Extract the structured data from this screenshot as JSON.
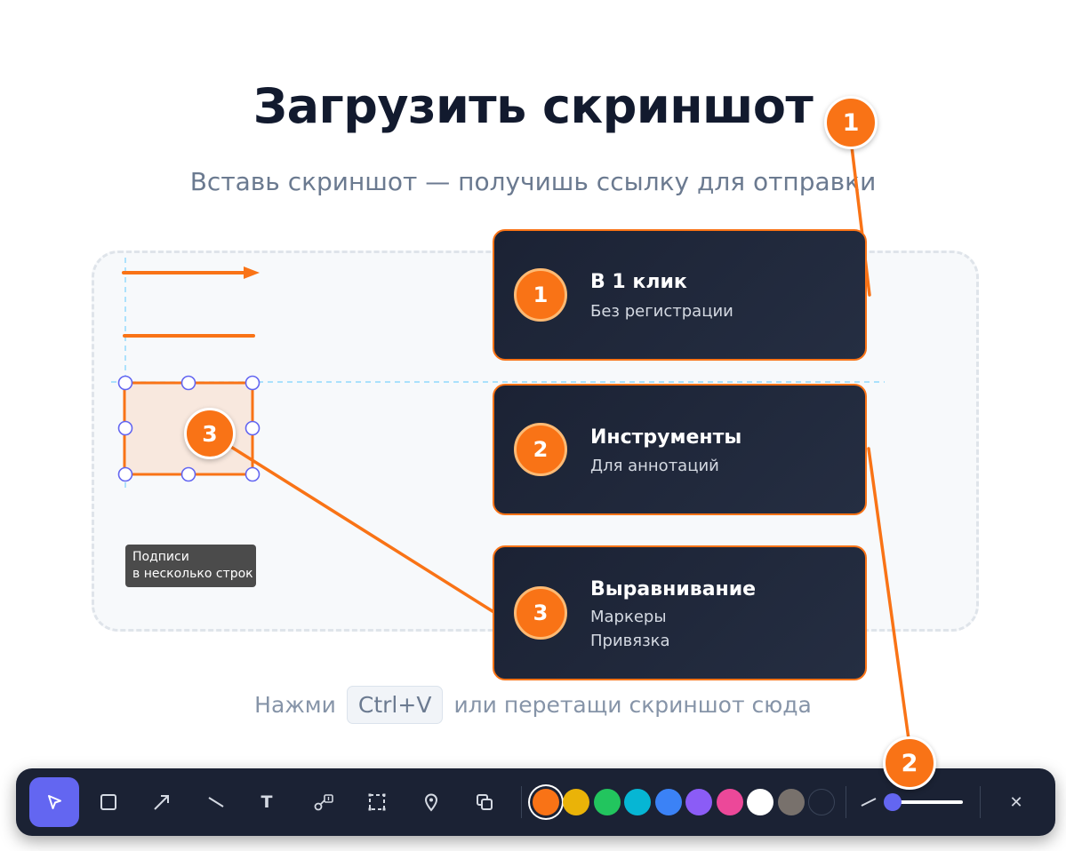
{
  "header": {
    "title": "Загрузить скриншот",
    "subtitle": "Вставь скриншот — получишь ссылку для отправки"
  },
  "hint": {
    "prefix": "Нажми",
    "shortcut": "Ctrl+V",
    "suffix": "или перетащи скриншот сюда"
  },
  "tooltip": {
    "line1": "Подписи",
    "line2": "в несколько строк"
  },
  "cards": [
    {
      "num": "1",
      "title": "В 1 клик",
      "lines": [
        "Без регистрации"
      ]
    },
    {
      "num": "2",
      "title": "Инструменты",
      "lines": [
        "Для аннотаций"
      ]
    },
    {
      "num": "3",
      "title": "Выравнивание",
      "lines": [
        "Маркеры",
        "Привязка"
      ]
    }
  ],
  "markers": {
    "top": "1",
    "toolbar": "2",
    "rect": "3"
  },
  "toolbar": {
    "tools": [
      "select-tool",
      "rectangle-tool",
      "arrow-tool",
      "line-tool",
      "text-tool",
      "numbered-callout-tool",
      "selection-frame-tool",
      "pin-tool",
      "copy-tool"
    ],
    "active_tool": "select-tool",
    "text_tool_glyph": "T",
    "colors": [
      "#f97316",
      "#eab308",
      "#22c55e",
      "#06b6d4",
      "#3b82f6",
      "#8b5cf6",
      "#ec4899",
      "#ffffff",
      "#78716c",
      "#1b2234"
    ],
    "selected_color": "#f97316",
    "close_glyph": "✕"
  },
  "accent": "#f97316"
}
